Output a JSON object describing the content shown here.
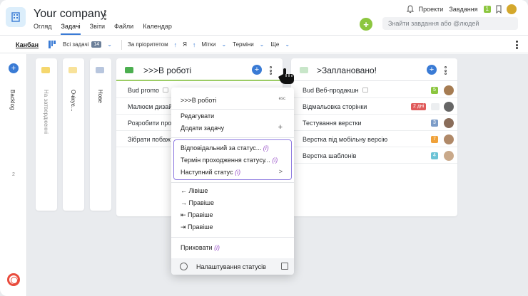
{
  "header": {
    "company": "Your company",
    "tabs": [
      {
        "label": "Огляд"
      },
      {
        "label": "Задачі"
      },
      {
        "label": "Звіти"
      },
      {
        "label": "Файли"
      },
      {
        "label": "Календар"
      }
    ],
    "nav_projects": "Проекти",
    "nav_tasks": "Завдання",
    "tasks_count": "1",
    "search_placeholder": "Знайти завдання або @людей"
  },
  "toolbar": {
    "kanban": "Канбан",
    "all_tasks": "Всі задачі",
    "all_tasks_count": "14",
    "by_priority": "За пріоритетом",
    "me": "Я",
    "tags": "Мітки",
    "deadlines": "Терміни",
    "more": "Ще"
  },
  "rail": {
    "backlog": "Backlog",
    "backlog_count": "2"
  },
  "collapsed_columns": [
    {
      "label": "На затвердженні",
      "color": "#f5d76e"
    },
    {
      "label": "Очікує...",
      "color": "#f8e29a"
    },
    {
      "label": "Нове",
      "color": "#b8c6de"
    }
  ],
  "column_in_progress": {
    "title": ">>>В роботі",
    "color": "#4caf50",
    "tasks": [
      {
        "text": "Bud promo"
      },
      {
        "text": "Малюєм дизай"
      },
      {
        "text": "Розробити про"
      },
      {
        "text": "Зібрати побаж"
      }
    ]
  },
  "column_planned": {
    "title": ">Заплановано!",
    "color": "#c8e6c9",
    "tasks": [
      {
        "text": "Bud Веб-продакшн",
        "badge": "5",
        "badge_color": "#8cc63f"
      },
      {
        "text": "Відмальовка сторінки",
        "badge": "2 дні",
        "badge_color": "#e05b5b"
      },
      {
        "text": "Тестування верстки",
        "badge": "3",
        "badge_color": "#7c9cc8"
      },
      {
        "text": "Верстка під мобільну версію",
        "badge": "7",
        "badge_color": "#f0a23a"
      },
      {
        "text": "Верстка шаблонів",
        "badge": "4",
        "badge_color": "#6cc3d6"
      }
    ]
  },
  "menu": {
    "title": ">>>В роботі",
    "esc": "esc",
    "edit": "Редагувати",
    "add_task": "Додати задачу",
    "responsible": "Відповідальний за статус...",
    "deadline": "Термін проходження статусу...",
    "next_status": "Наступний статус",
    "hint": "(i)",
    "left": "← Лівіше",
    "right1": "→ Правіше",
    "right2": "⇤ Правіше",
    "right3": "⇥ Правіше",
    "hide": "Приховати",
    "settings": "Налаштування статусів"
  }
}
